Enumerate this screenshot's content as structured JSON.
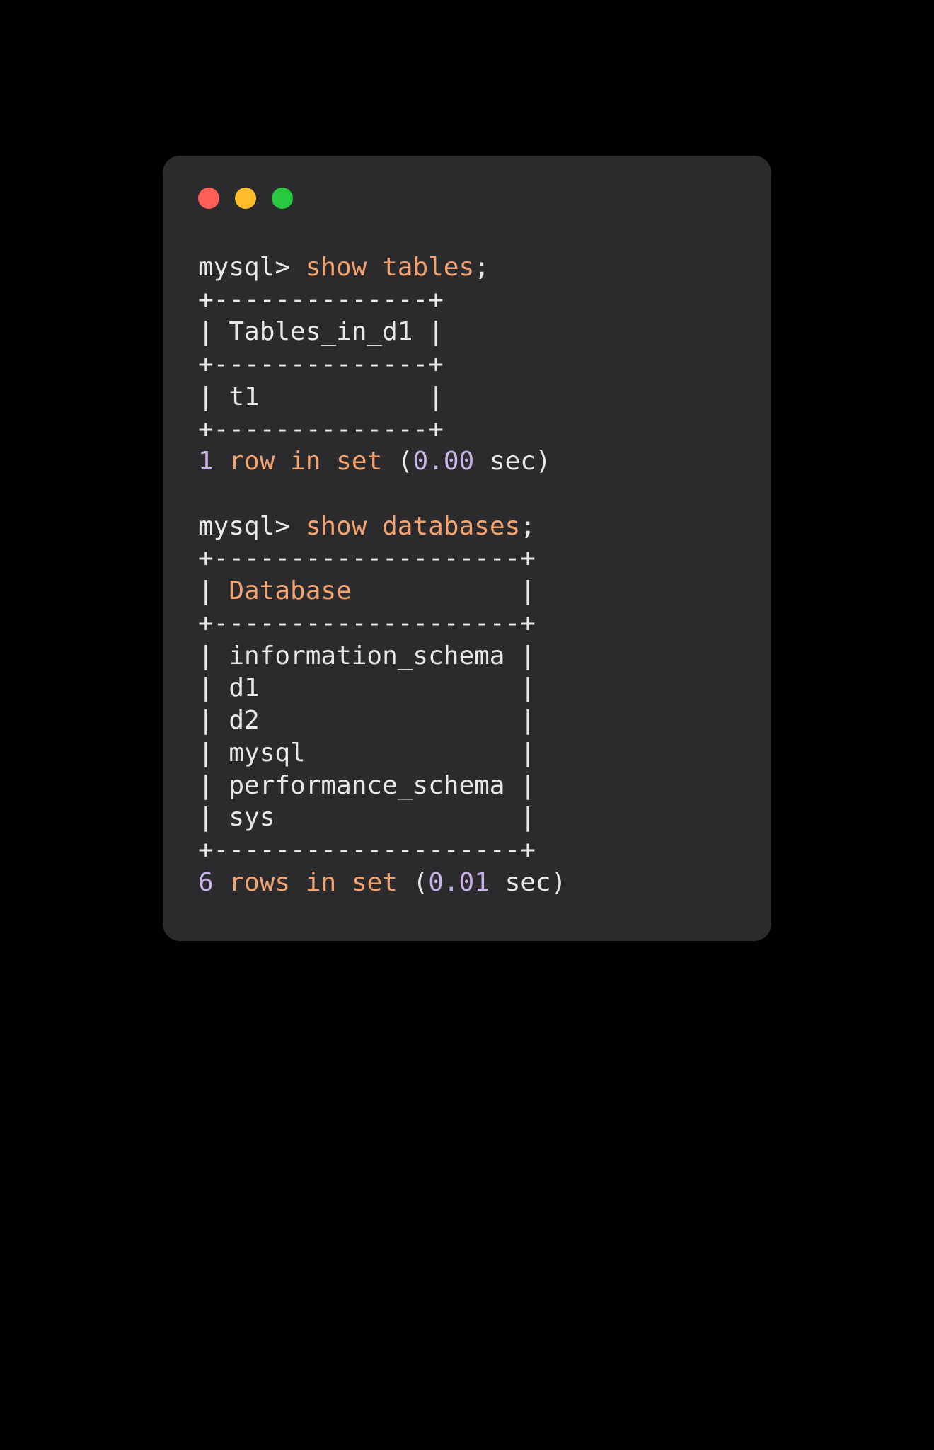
{
  "prompt": "mysql> ",
  "blocks": [
    {
      "cmd_kw": "show",
      "cmd_arg": "tables",
      "cmd_tail": ";",
      "border_top": "+--------------+",
      "header_row": "| Tables_in_d1 |",
      "border_mid": "+--------------+",
      "data_rows": [
        "| t1           |"
      ],
      "border_bot": "+--------------+",
      "result_count": "1",
      "result_noun": "row",
      "result_in": "in",
      "result_set": "set",
      "result_open": "(",
      "result_time": "0.00",
      "result_close": " sec)"
    },
    {
      "cmd_kw": "show",
      "cmd_arg": "databases",
      "cmd_tail": ";",
      "border_top": "+--------------------+",
      "header_row_pre": "| ",
      "header_row_hl": "Database",
      "header_row_post": "           |",
      "border_mid": "+--------------------+",
      "data_rows": [
        "| information_schema |",
        "| d1                 |",
        "| d2                 |",
        "| mysql              |",
        "| performance_schema |",
        "| sys                |"
      ],
      "border_bot": "+--------------------+",
      "result_count": "6",
      "result_noun": "rows",
      "result_in": "in",
      "result_set": "set",
      "result_open": "(",
      "result_time": "0.01",
      "result_close": " sec)"
    }
  ]
}
